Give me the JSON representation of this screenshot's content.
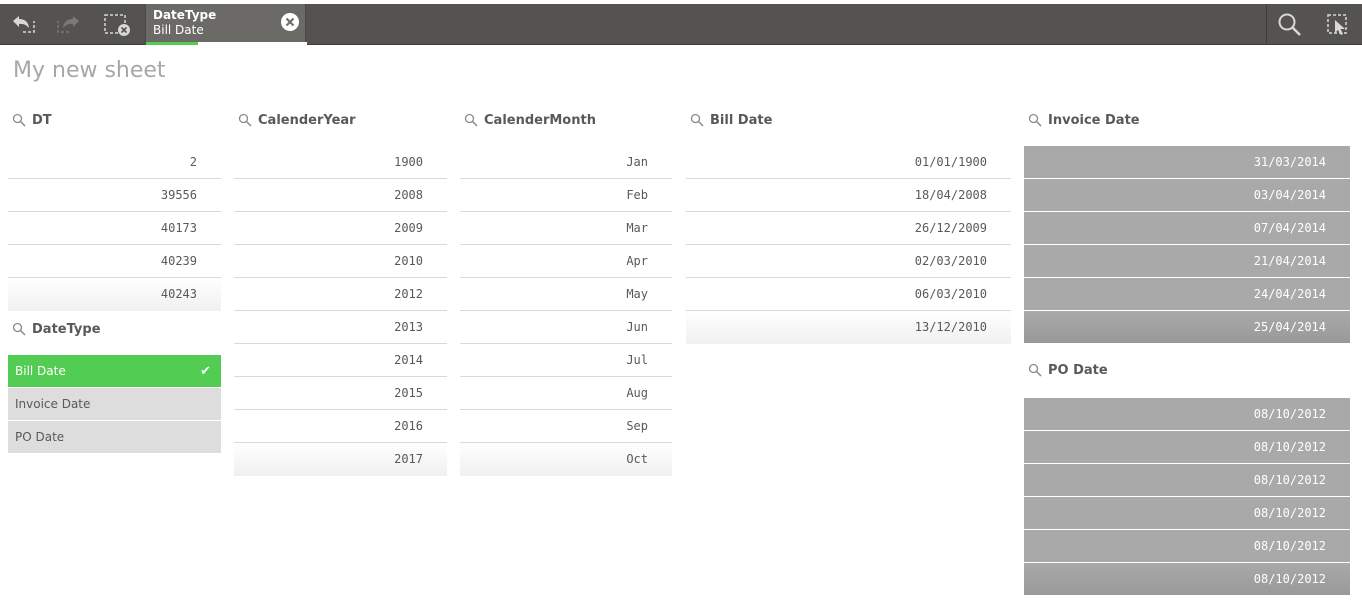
{
  "toolbar": {
    "buttons": {
      "back": "step-back-icon",
      "forward": "step-forward-icon",
      "clear_all": "clear-selections-icon",
      "search": "search-icon",
      "selections_tool": "selections-tool-icon"
    },
    "current_selection": {
      "field": "DateType",
      "value": "Bill Date"
    }
  },
  "sheet": {
    "title": "My new sheet"
  },
  "listboxes": {
    "dt": {
      "title": "DT",
      "values": [
        "2",
        "39556",
        "40173",
        "40239",
        "40243"
      ]
    },
    "datetype": {
      "title": "DateType",
      "values": [
        {
          "label": "Bill Date",
          "state": "selected"
        },
        {
          "label": "Invoice Date",
          "state": "alternative"
        },
        {
          "label": "PO Date",
          "state": "alternative"
        }
      ]
    },
    "calender_year": {
      "title": "CalenderYear",
      "values": [
        "1900",
        "2008",
        "2009",
        "2010",
        "2012",
        "2013",
        "2014",
        "2015",
        "2016",
        "2017"
      ]
    },
    "calender_month": {
      "title": "CalenderMonth",
      "values": [
        "Jan",
        "Feb",
        "Mar",
        "Apr",
        "May",
        "Jun",
        "Jul",
        "Aug",
        "Sep",
        "Oct"
      ]
    },
    "bill_date": {
      "title": "Bill Date",
      "values": [
        "01/01/1900",
        "18/04/2008",
        "26/12/2009",
        "02/03/2010",
        "06/03/2010",
        "13/12/2010"
      ]
    },
    "invoice_date": {
      "title": "Invoice Date",
      "values": [
        "31/03/2014",
        "03/04/2014",
        "07/04/2014",
        "21/04/2014",
        "24/04/2014",
        "25/04/2014"
      ]
    },
    "po_date": {
      "title": "PO Date",
      "values": [
        "08/10/2012",
        "08/10/2012",
        "08/10/2012",
        "08/10/2012",
        "08/10/2012",
        "08/10/2012"
      ]
    }
  },
  "colors": {
    "toolbar": "#555350",
    "selected": "#52cc52",
    "alternative": "#dddddd",
    "excluded": "#a9a9a9"
  }
}
